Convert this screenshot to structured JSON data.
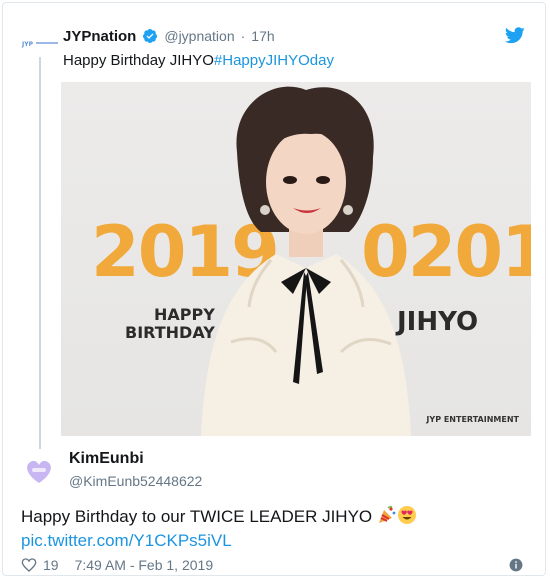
{
  "quoted": {
    "name": "JYPnation",
    "handle": "@jypnation",
    "dot": "·",
    "time": "17h",
    "text": "Happy Birthday JIHYO",
    "hashtag": "#HappyJIHYOday"
  },
  "photo": {
    "year": "2019",
    "date": "0201",
    "happy_birthday_line1": "HAPPY",
    "happy_birthday_line2": "BIRTHDAY",
    "name": "JIHYO",
    "watermark": "JYP ENTERTAINMENT"
  },
  "main": {
    "name": "KimEunbi",
    "handle": "@KimEunb52448622",
    "text": "Happy Birthday to our TWICE LEADER JIHYO",
    "link": "pic.twitter.com/Y1CKPs5iVL",
    "likes": "19",
    "timestamp": "7:49 AM - Feb 1, 2019"
  },
  "icons": {
    "verified": "verified-badge-icon",
    "twitter": "twitter-bird-icon",
    "heart": "heart-icon",
    "info": "info-icon",
    "party": "party-popper-icon",
    "heart_eyes": "heart-eyes-emoji-icon"
  },
  "colors": {
    "link": "#1b95e0",
    "accent_orange": "#f0a93a",
    "muted": "#657786"
  }
}
